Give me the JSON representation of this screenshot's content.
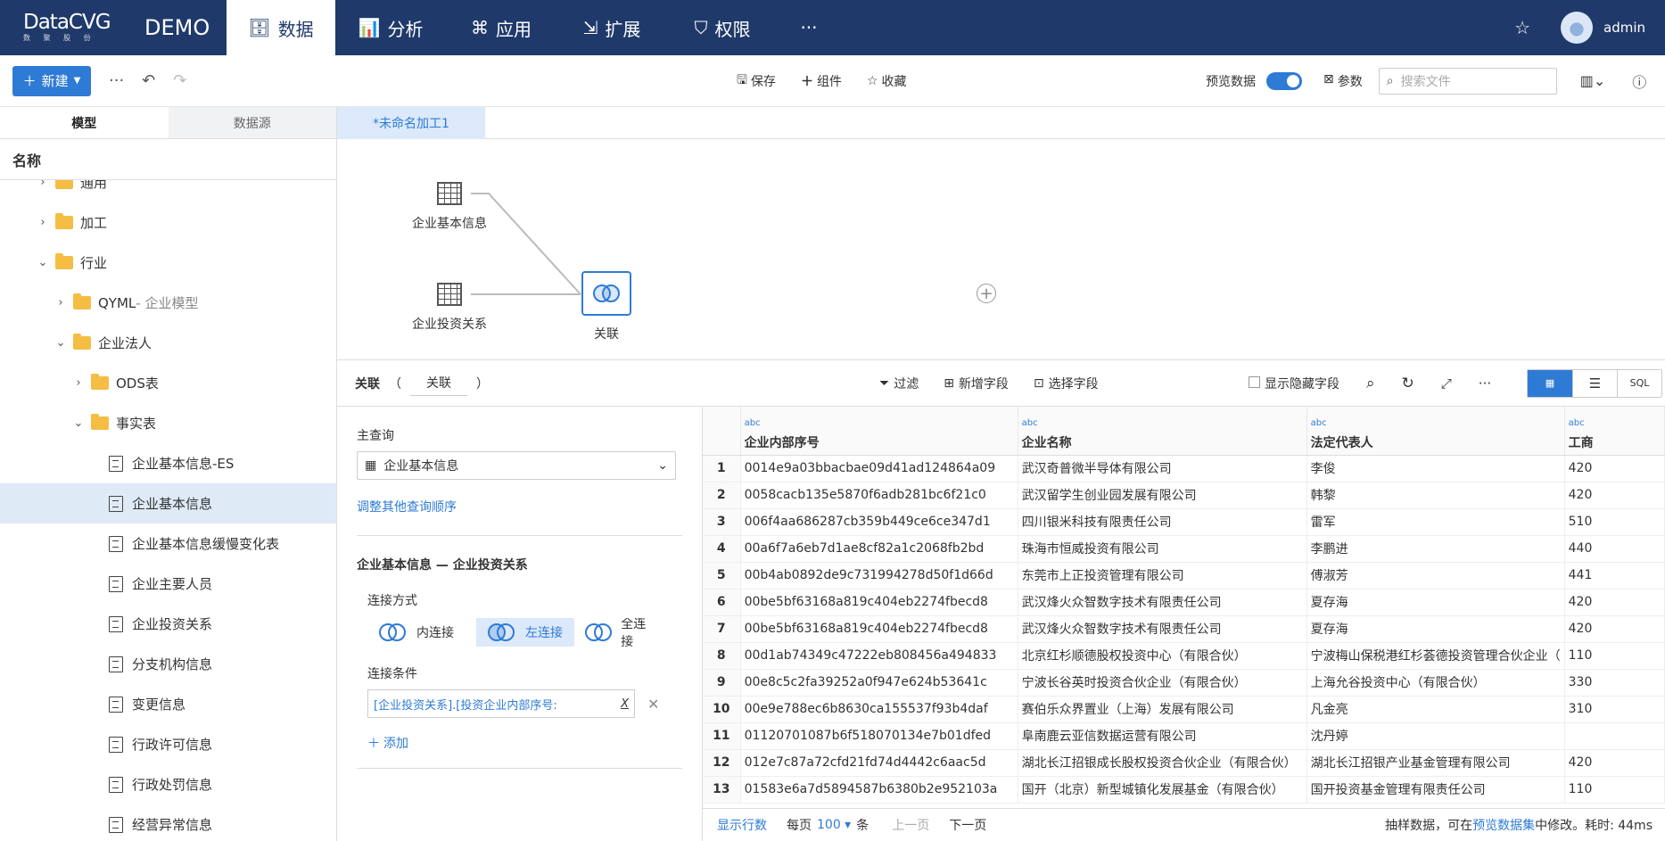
{
  "nav": {
    "logo": "DataCVG",
    "logo_sub": "数 聚 股 份",
    "demo": "DEMO",
    "items": [
      "数据",
      "分析",
      "应用",
      "扩展",
      "权限"
    ],
    "more": "···",
    "user": "admin"
  },
  "toolbar": {
    "new": "新建",
    "save": "保存",
    "component": "组件",
    "favorite": "收藏",
    "preview": "预览数据",
    "params": "参数",
    "search_placeholder": "搜索文件"
  },
  "left": {
    "tabs": [
      "模型",
      "数据源"
    ],
    "header": "名称",
    "tree": [
      {
        "label": "通用",
        "suffix": ""
      },
      {
        "label": "加工",
        "suffix": ""
      },
      {
        "label": "行业",
        "suffix": ""
      },
      {
        "label": "QYML",
        "suffix": " - 企业模型"
      },
      {
        "label": "企业法人",
        "suffix": ""
      },
      {
        "label": "ODS表",
        "suffix": ""
      },
      {
        "label": "事实表",
        "suffix": ""
      },
      {
        "label": "企业基本信息-ES"
      },
      {
        "label": "企业基本信息"
      },
      {
        "label": "企业基本信息缓慢变化表"
      },
      {
        "label": "企业主要人员"
      },
      {
        "label": "企业投资关系"
      },
      {
        "label": "分支机构信息"
      },
      {
        "label": "变更信息"
      },
      {
        "label": "行政许可信息"
      },
      {
        "label": "行政处罚信息"
      },
      {
        "label": "经营异常信息"
      }
    ]
  },
  "work_tab": "*未命名加工1",
  "canvas": {
    "node1": "企业基本信息",
    "node2": "企业投资关系",
    "join": "关联"
  },
  "joinbar": {
    "label": "关联",
    "paren_open": "（",
    "name": "关联",
    "paren_close": "）",
    "filter": "过滤",
    "add_field": "新增字段",
    "select_field": "选择字段",
    "show_hidden": "显示隐藏字段",
    "sql": "SQL"
  },
  "config": {
    "main_query": "主查询",
    "main_value": "企业基本信息",
    "adjust": "调整其他查询顺序",
    "relation": "企业基本信息 — 企业投资关系",
    "join_type_label": "连接方式",
    "join_types": [
      "内连接",
      "左连接",
      "全连接"
    ],
    "cond_label": "连接条件",
    "cond_value": "[企业投资关系].[投资企业内部序号:",
    "cond_x": "X",
    "add": "添加"
  },
  "grid": {
    "type": "abc",
    "columns": [
      "企业内部序号",
      "企业名称",
      "法定代表人",
      "工商"
    ],
    "rows": [
      [
        "1",
        "0014e9a03bbacbae09d41ad124864a09",
        "武汉奇普微半导体有限公司",
        "李俊",
        "420"
      ],
      [
        "2",
        "0058cacb135e5870f6adb281bc6f21c0",
        "武汉留学生创业园发展有限公司",
        "韩黎",
        "420"
      ],
      [
        "3",
        "006f4aa686287cb359b449ce6ce347d1",
        "四川银米科技有限责任公司",
        "雷军",
        "510"
      ],
      [
        "4",
        "00a6f7a6eb7d1ae8cf82a1c2068fb2bd",
        "珠海市恒威投资有限公司",
        "李鹏进",
        "440"
      ],
      [
        "5",
        "00b4ab0892de9c731994278d50f1d66d",
        "东莞市上正投资管理有限公司",
        "傅淑芳",
        "441"
      ],
      [
        "6",
        "00be5bf63168a819c404eb2274fbecd8",
        "武汉烽火众智数字技术有限责任公司",
        "夏存海",
        "420"
      ],
      [
        "7",
        "00be5bf63168a819c404eb2274fbecd8",
        "武汉烽火众智数字技术有限责任公司",
        "夏存海",
        "420"
      ],
      [
        "8",
        "00d1ab74349c47222eb808456a494833",
        "北京红杉顺德股权投资中心（有限合伙）",
        "宁波梅山保税港红杉荟德投资管理合伙企业（",
        "110"
      ],
      [
        "9",
        "00e8c5c2fa39252a0f947e624b53641c",
        "宁波长谷英时投资合伙企业（有限合伙）",
        "上海允谷投资中心（有限合伙）",
        "330"
      ],
      [
        "10",
        "00e9e788ec6b8630ca155537f93b4daf",
        "赛伯乐众界置业（上海）发展有限公司",
        "凡金亮",
        "310"
      ],
      [
        "11",
        "01120701087b6f518070134e7b01dfed",
        "阜南鹿云亚信数据运营有限公司",
        "沈丹婷",
        ""
      ],
      [
        "12",
        "012e7c87a72cfd21fd74d4442c6aac5d",
        "湖北长江招银成长股权投资合伙企业（有限合伙）",
        "湖北长江招银产业基金管理有限公司",
        "420"
      ],
      [
        "13",
        "01583e6a7d5894587b6380b2e952103a",
        "国开（北京）新型城镇化发展基金（有限合伙）",
        "国开投资基金管理有限责任公司",
        "110"
      ]
    ]
  },
  "footer": {
    "show_rows": "显示行数",
    "per_page": "每页",
    "count": "100",
    "unit": "条",
    "prev": "上一页",
    "next": "下一页",
    "note_a": "抽样数据，可在",
    "note_link": "预览数据集",
    "note_b": "中修改。耗时: 44ms"
  }
}
